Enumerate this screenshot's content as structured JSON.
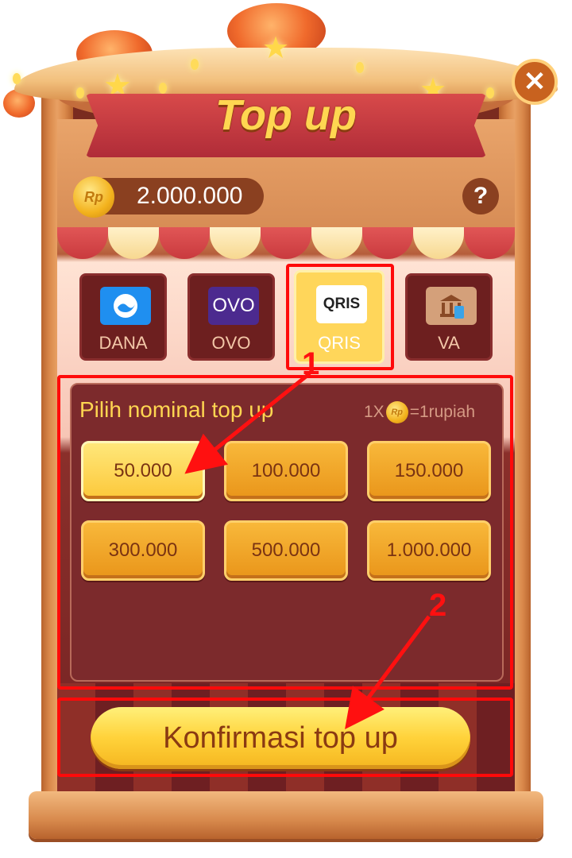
{
  "dialog": {
    "title": "Top up",
    "close_label": "✕",
    "help_label": "?"
  },
  "balance": {
    "currency_badge": "Rp",
    "amount": "2.000.000"
  },
  "payment_methods": [
    {
      "label": "DANA",
      "icon": "dana-logo-icon",
      "selected": false
    },
    {
      "label": "OVO",
      "icon_text": "OVO",
      "selected": false
    },
    {
      "label": "QRIS",
      "icon_text": "QRIS",
      "selected": true
    },
    {
      "label": "VA",
      "icon": "bank-icon",
      "selected": false
    }
  ],
  "nominal": {
    "title": "Pilih nominal top up",
    "rate_prefix": "1X",
    "rate_coin": "Rp",
    "rate_suffix": "=1rupiah",
    "options": [
      "50.000",
      "100.000",
      "150.000",
      "300.000",
      "500.000",
      "1.000.000"
    ],
    "selected": "50.000"
  },
  "confirm_label": "Konfirmasi top up",
  "annotations": [
    "1",
    "2"
  ],
  "colors": {
    "annotation": "#ff0a0a",
    "title": "#ffd651",
    "button": "#f8b83a",
    "selected_button": "#ffe77a"
  }
}
